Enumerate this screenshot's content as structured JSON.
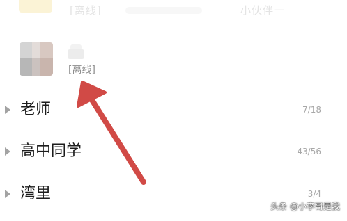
{
  "top_row": {
    "left_text": "[离线]",
    "right_text": "小伙伴一"
  },
  "friend": {
    "status": "[离线]"
  },
  "groups": [
    {
      "name": "老师",
      "count": "7/18"
    },
    {
      "name": "高中同学",
      "count": "43/56"
    },
    {
      "name": "湾里",
      "count": "3/4"
    }
  ],
  "annotation": {
    "arrow_color": "#d14a46"
  },
  "watermark": "头条 @小李哥是我"
}
